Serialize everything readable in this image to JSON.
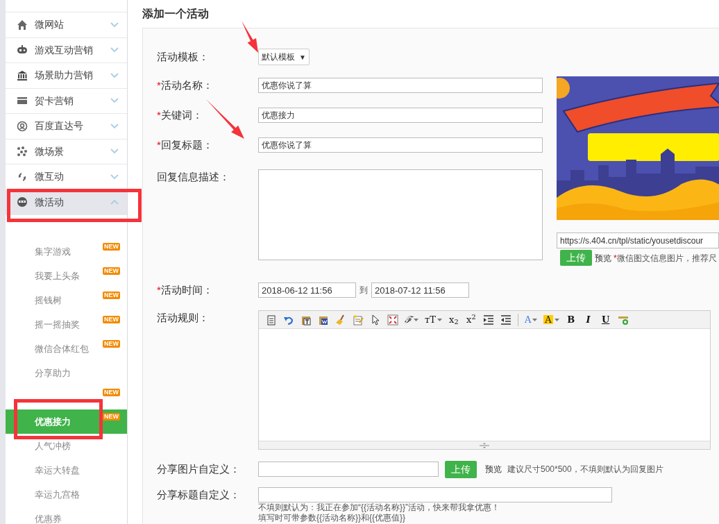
{
  "sidebar": {
    "items": [
      {
        "label": "微网站",
        "expanded": false
      },
      {
        "label": "游戏互动营销",
        "expanded": false
      },
      {
        "label": "场景助力营销",
        "expanded": false
      },
      {
        "label": "贺卡营销",
        "expanded": false
      },
      {
        "label": "百度直达号",
        "expanded": false
      },
      {
        "label": "微场景",
        "expanded": false
      },
      {
        "label": "微互动",
        "expanded": false
      },
      {
        "label": "微活动",
        "expanded": true,
        "children": [
          {
            "label": "集字游戏",
            "badge": "NEW",
            "selected": false
          },
          {
            "label": "我要上头条",
            "badge": "NEW",
            "selected": false
          },
          {
            "label": "摇钱树",
            "badge": "NEW",
            "selected": false
          },
          {
            "label": "摇一摇抽奖",
            "badge": "NEW",
            "selected": false
          },
          {
            "label": "微信合体红包",
            "badge": "NEW",
            "selected": false
          },
          {
            "label": "分享助力",
            "selected": false
          },
          {
            "badge": "NEW",
            "selected": false
          },
          {
            "label": "优惠接力",
            "badge": "NEW",
            "selected": true
          },
          {
            "label": "人气冲榜",
            "selected": false
          },
          {
            "label": "幸运大转盘",
            "selected": false
          },
          {
            "label": "幸运九宫格",
            "selected": false
          },
          {
            "label": "优惠券",
            "selected": false
          }
        ]
      }
    ]
  },
  "page_title": "添加一个活动",
  "form": {
    "template": {
      "label": "活动模板：",
      "value": "默认模板",
      "caret": "▼"
    },
    "name": {
      "label": "活动名称：",
      "required_mark": "*",
      "value": "优惠你说了算"
    },
    "keyword": {
      "label": "关键词：",
      "required_mark": "*",
      "value": "优惠接力"
    },
    "reply_title": {
      "label": "回复标题：",
      "required_mark": "*",
      "value": "优惠你说了算"
    },
    "description": {
      "label": "回复信息描述："
    },
    "cover": {
      "kind": "picture",
      "url": "https://s.404.cn/tpl/static/yousetdiscour",
      "upload": "上传",
      "preview": "预览",
      "hint_mark": "*",
      "hint": "微信图文信息图片，推荐尺"
    },
    "time": {
      "label": "活动时间：",
      "required_mark": "*",
      "start": "2018-06-12 11:56",
      "separator": "到",
      "end": "2018-07-12 11:56"
    },
    "rules": {
      "label": "活动规则：",
      "toolbar": [
        {
          "kind": "paste"
        },
        {
          "kind": "undo"
        },
        {
          "kind": "paste-text"
        },
        {
          "kind": "paste-word"
        },
        {
          "kind": "broom"
        },
        {
          "kind": "notepad"
        },
        {
          "kind": "pointer"
        },
        {
          "kind": "fullscreen"
        },
        {
          "kind": "glyph",
          "text": "ℱ",
          "caret": true,
          "italic": true
        },
        {
          "kind": "glyph",
          "text": "тT",
          "caret": true
        },
        {
          "kind": "glyph",
          "text": "x$_{2}$"
        },
        {
          "kind": "glyph",
          "text": "x$^{2}$"
        },
        {
          "kind": "indent"
        },
        {
          "kind": "outdent"
        },
        {
          "kind": "separator"
        },
        {
          "kind": "glyph",
          "text": "A",
          "caret": true,
          "color": "#3b7ddd"
        },
        {
          "kind": "glyph",
          "text": "A",
          "caret": true,
          "color": "#ffcc00",
          "filled": true
        },
        {
          "kind": "glyph",
          "text": "B",
          "bold": true
        },
        {
          "kind": "glyph",
          "text": "I",
          "italic": true,
          "bold": true
        },
        {
          "kind": "glyph",
          "text": "U",
          "underline": true,
          "bold": true
        },
        {
          "kind": "rule"
        }
      ]
    },
    "share_image": {
      "label": "分享图片自定义：",
      "upload": "上传",
      "preview": "预览",
      "hint": "建议尺寸500*500，不填则默认为回复图片"
    },
    "share_title": {
      "label": "分享标题自定义：",
      "hints": [
        "不填则默认为：我正在参加“{{活动名称}}”活动，快来帮我拿优惠！",
        "填写时可带参数{{活动名称}}和{{优惠值}}"
      ]
    }
  },
  "annotations": [
    {
      "kind": "frame"
    },
    {
      "kind": "frame"
    },
    {
      "kind": "arrow"
    },
    {
      "kind": "arrow"
    }
  ]
}
